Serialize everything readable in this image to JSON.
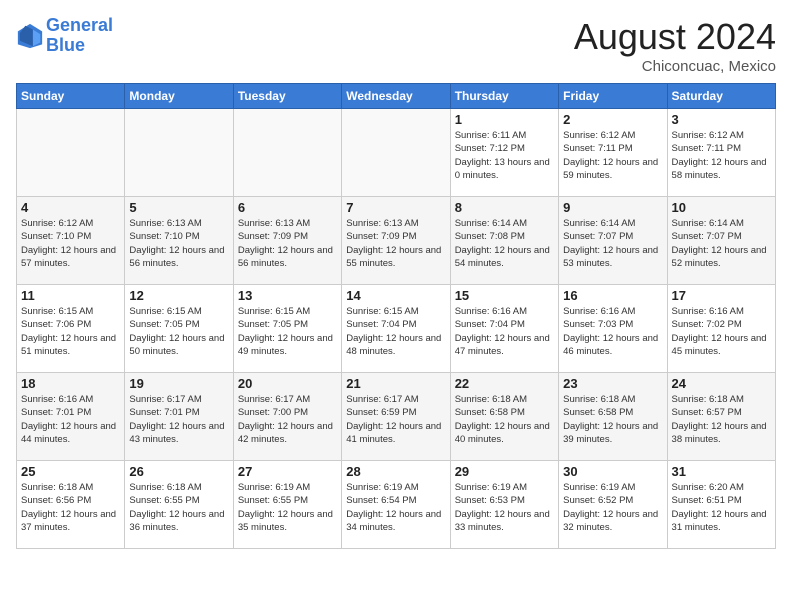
{
  "header": {
    "logo_line1": "General",
    "logo_line2": "Blue",
    "month": "August 2024",
    "location": "Chiconcuac, Mexico"
  },
  "weekdays": [
    "Sunday",
    "Monday",
    "Tuesday",
    "Wednesday",
    "Thursday",
    "Friday",
    "Saturday"
  ],
  "weeks": [
    [
      {
        "day": "",
        "info": ""
      },
      {
        "day": "",
        "info": ""
      },
      {
        "day": "",
        "info": ""
      },
      {
        "day": "",
        "info": ""
      },
      {
        "day": "1",
        "info": "Sunrise: 6:11 AM\nSunset: 7:12 PM\nDaylight: 13 hours and 0 minutes."
      },
      {
        "day": "2",
        "info": "Sunrise: 6:12 AM\nSunset: 7:11 PM\nDaylight: 12 hours and 59 minutes."
      },
      {
        "day": "3",
        "info": "Sunrise: 6:12 AM\nSunset: 7:11 PM\nDaylight: 12 hours and 58 minutes."
      }
    ],
    [
      {
        "day": "4",
        "info": "Sunrise: 6:12 AM\nSunset: 7:10 PM\nDaylight: 12 hours and 57 minutes."
      },
      {
        "day": "5",
        "info": "Sunrise: 6:13 AM\nSunset: 7:10 PM\nDaylight: 12 hours and 56 minutes."
      },
      {
        "day": "6",
        "info": "Sunrise: 6:13 AM\nSunset: 7:09 PM\nDaylight: 12 hours and 56 minutes."
      },
      {
        "day": "7",
        "info": "Sunrise: 6:13 AM\nSunset: 7:09 PM\nDaylight: 12 hours and 55 minutes."
      },
      {
        "day": "8",
        "info": "Sunrise: 6:14 AM\nSunset: 7:08 PM\nDaylight: 12 hours and 54 minutes."
      },
      {
        "day": "9",
        "info": "Sunrise: 6:14 AM\nSunset: 7:07 PM\nDaylight: 12 hours and 53 minutes."
      },
      {
        "day": "10",
        "info": "Sunrise: 6:14 AM\nSunset: 7:07 PM\nDaylight: 12 hours and 52 minutes."
      }
    ],
    [
      {
        "day": "11",
        "info": "Sunrise: 6:15 AM\nSunset: 7:06 PM\nDaylight: 12 hours and 51 minutes."
      },
      {
        "day": "12",
        "info": "Sunrise: 6:15 AM\nSunset: 7:05 PM\nDaylight: 12 hours and 50 minutes."
      },
      {
        "day": "13",
        "info": "Sunrise: 6:15 AM\nSunset: 7:05 PM\nDaylight: 12 hours and 49 minutes."
      },
      {
        "day": "14",
        "info": "Sunrise: 6:15 AM\nSunset: 7:04 PM\nDaylight: 12 hours and 48 minutes."
      },
      {
        "day": "15",
        "info": "Sunrise: 6:16 AM\nSunset: 7:04 PM\nDaylight: 12 hours and 47 minutes."
      },
      {
        "day": "16",
        "info": "Sunrise: 6:16 AM\nSunset: 7:03 PM\nDaylight: 12 hours and 46 minutes."
      },
      {
        "day": "17",
        "info": "Sunrise: 6:16 AM\nSunset: 7:02 PM\nDaylight: 12 hours and 45 minutes."
      }
    ],
    [
      {
        "day": "18",
        "info": "Sunrise: 6:16 AM\nSunset: 7:01 PM\nDaylight: 12 hours and 44 minutes."
      },
      {
        "day": "19",
        "info": "Sunrise: 6:17 AM\nSunset: 7:01 PM\nDaylight: 12 hours and 43 minutes."
      },
      {
        "day": "20",
        "info": "Sunrise: 6:17 AM\nSunset: 7:00 PM\nDaylight: 12 hours and 42 minutes."
      },
      {
        "day": "21",
        "info": "Sunrise: 6:17 AM\nSunset: 6:59 PM\nDaylight: 12 hours and 41 minutes."
      },
      {
        "day": "22",
        "info": "Sunrise: 6:18 AM\nSunset: 6:58 PM\nDaylight: 12 hours and 40 minutes."
      },
      {
        "day": "23",
        "info": "Sunrise: 6:18 AM\nSunset: 6:58 PM\nDaylight: 12 hours and 39 minutes."
      },
      {
        "day": "24",
        "info": "Sunrise: 6:18 AM\nSunset: 6:57 PM\nDaylight: 12 hours and 38 minutes."
      }
    ],
    [
      {
        "day": "25",
        "info": "Sunrise: 6:18 AM\nSunset: 6:56 PM\nDaylight: 12 hours and 37 minutes."
      },
      {
        "day": "26",
        "info": "Sunrise: 6:18 AM\nSunset: 6:55 PM\nDaylight: 12 hours and 36 minutes."
      },
      {
        "day": "27",
        "info": "Sunrise: 6:19 AM\nSunset: 6:55 PM\nDaylight: 12 hours and 35 minutes."
      },
      {
        "day": "28",
        "info": "Sunrise: 6:19 AM\nSunset: 6:54 PM\nDaylight: 12 hours and 34 minutes."
      },
      {
        "day": "29",
        "info": "Sunrise: 6:19 AM\nSunset: 6:53 PM\nDaylight: 12 hours and 33 minutes."
      },
      {
        "day": "30",
        "info": "Sunrise: 6:19 AM\nSunset: 6:52 PM\nDaylight: 12 hours and 32 minutes."
      },
      {
        "day": "31",
        "info": "Sunrise: 6:20 AM\nSunset: 6:51 PM\nDaylight: 12 hours and 31 minutes."
      }
    ]
  ]
}
